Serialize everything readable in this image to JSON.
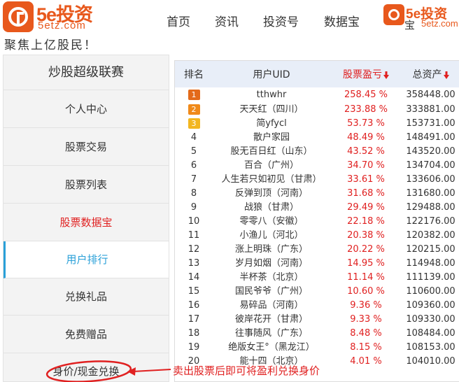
{
  "header": {
    "logo_big": "5e投资",
    "logo_small": "5etz.com",
    "slogan": "聚焦上亿股民！",
    "nav": [
      "首页",
      "资讯",
      "投资号",
      "数据宝"
    ],
    "logo2_big": "5e投资",
    "logo2_small": "5etz.com",
    "logo2_under": "宝"
  },
  "sidebar": {
    "title": "炒股超级联赛",
    "items": [
      {
        "label": "个人中心"
      },
      {
        "label": "股票交易"
      },
      {
        "label": "股票列表"
      },
      {
        "label": "股票数据宝"
      },
      {
        "label": "用户排行"
      },
      {
        "label": "兑换礼品"
      },
      {
        "label": "免费赠品"
      },
      {
        "label": "身价/现金兑换"
      }
    ]
  },
  "table": {
    "headers": [
      "排名",
      "用户UID",
      "股票盈亏",
      "总资产"
    ],
    "rows": [
      {
        "rank": "1",
        "uid": "tthwhr",
        "profit": "258.45 %",
        "asset": "358448.00"
      },
      {
        "rank": "2",
        "uid": "天天红（四川）",
        "profit": "233.88 %",
        "asset": "333881.00"
      },
      {
        "rank": "3",
        "uid": "简yfycl",
        "profit": "53.73 %",
        "asset": "153731.00"
      },
      {
        "rank": "4",
        "uid": "散户家园",
        "profit": "48.49 %",
        "asset": "148491.00"
      },
      {
        "rank": "5",
        "uid": "股无百日红（山东）",
        "profit": "43.52 %",
        "asset": "143520.00"
      },
      {
        "rank": "6",
        "uid": "百合（广州）",
        "profit": "34.70 %",
        "asset": "134704.00"
      },
      {
        "rank": "7",
        "uid": "人生若只如初见（甘肃）",
        "profit": "33.61 %",
        "asset": "133606.00"
      },
      {
        "rank": "8",
        "uid": "反弹到顶（河南）",
        "profit": "31.68 %",
        "asset": "131680.00"
      },
      {
        "rank": "9",
        "uid": "战狼（甘肃）",
        "profit": "29.49 %",
        "asset": "129488.00"
      },
      {
        "rank": "10",
        "uid": "零零八（安徽）",
        "profit": "22.18 %",
        "asset": "122176.00"
      },
      {
        "rank": "11",
        "uid": "小渔儿（河北）",
        "profit": "20.38 %",
        "asset": "120382.00"
      },
      {
        "rank": "12",
        "uid": "涨上明珠（广东）",
        "profit": "20.22 %",
        "asset": "120215.00"
      },
      {
        "rank": "13",
        "uid": "岁月如烟（河南）",
        "profit": "14.95 %",
        "asset": "114948.00"
      },
      {
        "rank": "14",
        "uid": "半杯茶（北京）",
        "profit": "11.14 %",
        "asset": "111139.00"
      },
      {
        "rank": "15",
        "uid": "国民爷爷（广州）",
        "profit": "10.60 %",
        "asset": "110600.00"
      },
      {
        "rank": "16",
        "uid": "易碎品（河南）",
        "profit": "9.36 %",
        "asset": "109360.00"
      },
      {
        "rank": "17",
        "uid": "彼岸花开（甘肃）",
        "profit": "9.33 %",
        "asset": "109330.00"
      },
      {
        "rank": "18",
        "uid": "往事随风（广东）",
        "profit": "8.48 %",
        "asset": "108484.00"
      },
      {
        "rank": "19",
        "uid": "绝版女王°（黑龙江）",
        "profit": "8.15 %",
        "asset": "108153.00"
      },
      {
        "rank": "20",
        "uid": "能十四（北京）",
        "profit": "4.01 %",
        "asset": "104010.00"
      }
    ]
  },
  "annotation": {
    "text": "卖出股票后即可将盈利兑换身价"
  },
  "colors": {
    "brand": "#e8581c",
    "accent": "#2aa0d8",
    "red": "#e02020",
    "header_bg": "#e8eef8"
  }
}
